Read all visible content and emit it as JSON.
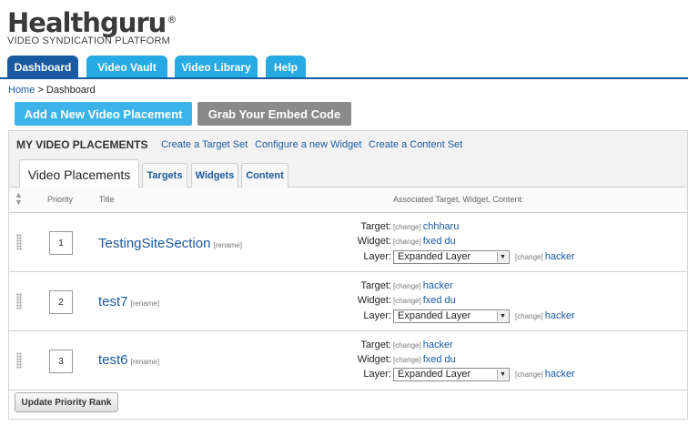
{
  "brand": {
    "logo": "Healthguru",
    "subtitle": "VIDEO SYNDICATION PLATFORM"
  },
  "nav": {
    "tabs": [
      {
        "label": "Dashboard"
      },
      {
        "label": "Video Vault"
      },
      {
        "label": "Video Library"
      },
      {
        "label": "Help"
      }
    ]
  },
  "breadcrumb": {
    "home": "Home",
    "separator": " > ",
    "current": "Dashboard"
  },
  "actions": {
    "add_label": "Add a New Video Placement",
    "embed_label": "Grab Your Embed Code"
  },
  "panel": {
    "title": "MY VIDEO PLACEMENTS",
    "links": [
      "Create a Target Set",
      "Configure a new Widget",
      "Create a Content Set"
    ],
    "subtabs": [
      "Video Placements",
      "Targets",
      "Widgets",
      "Content"
    ],
    "columns": {
      "priority": "Priority",
      "title": "Title",
      "assoc": "Associated Target, Widget, Content:"
    },
    "labels": {
      "target": "Target:",
      "widget": "Widget:",
      "layer": "Layer:",
      "change": "[change]",
      "rename": "[rename]"
    },
    "rows": [
      {
        "priority": "1",
        "title": "TestingSiteSection",
        "target": "chhharu",
        "widget": "fxed du",
        "layer": "Expanded Layer",
        "content": "hacker"
      },
      {
        "priority": "2",
        "title": "test7",
        "target": "hacker",
        "widget": "fxed du",
        "layer": "Expanded Layer",
        "content": "hacker"
      },
      {
        "priority": "3",
        "title": "test6",
        "target": "hacker",
        "widget": "fxed du",
        "layer": "Expanded Layer",
        "content": "hacker"
      }
    ],
    "update_label": "Update Priority Rank"
  },
  "colors": {
    "nav_active": "#1a5aa0",
    "nav_inactive": "#27a9e1",
    "add_button": "#3cb4ea",
    "embed_button": "#8a8a8a",
    "link": "#1a5aa0"
  }
}
